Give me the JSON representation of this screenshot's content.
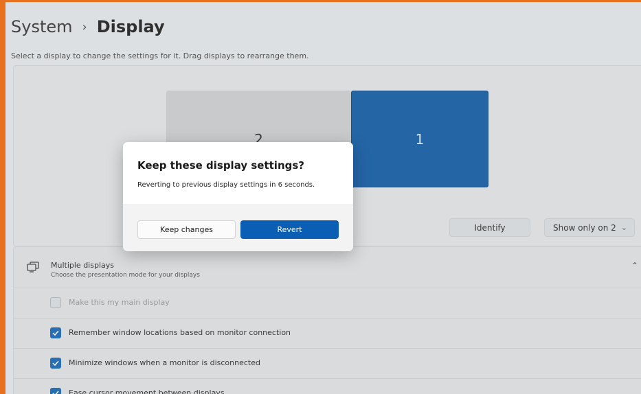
{
  "breadcrumb": {
    "parent": "System",
    "separator": "›",
    "current": "Display"
  },
  "instruction": "Select a display to change the settings for it. Drag displays to rearrange them.",
  "monitors": [
    {
      "label": "2"
    },
    {
      "label": "1"
    }
  ],
  "actions": {
    "identify": "Identify",
    "show_only": "Show only on 2"
  },
  "multiple_displays": {
    "title": "Multiple displays",
    "subtitle": "Choose the presentation mode for your displays",
    "options": [
      {
        "label": "Make this my main display",
        "checked": false,
        "disabled": true
      },
      {
        "label": "Remember window locations based on monitor connection",
        "checked": true,
        "disabled": false
      },
      {
        "label": "Minimize windows when a monitor is disconnected",
        "checked": true,
        "disabled": false
      },
      {
        "label": "Ease cursor movement between displays",
        "checked": true,
        "disabled": false
      }
    ]
  },
  "dialog": {
    "title": "Keep these display settings?",
    "message": "Reverting to previous display settings in  6 seconds.",
    "keep_label": "Keep changes",
    "revert_label": "Revert"
  },
  "colors": {
    "accent": "#0a5fb4",
    "frame": "#e8711d",
    "selected_monitor": "#06509a"
  }
}
